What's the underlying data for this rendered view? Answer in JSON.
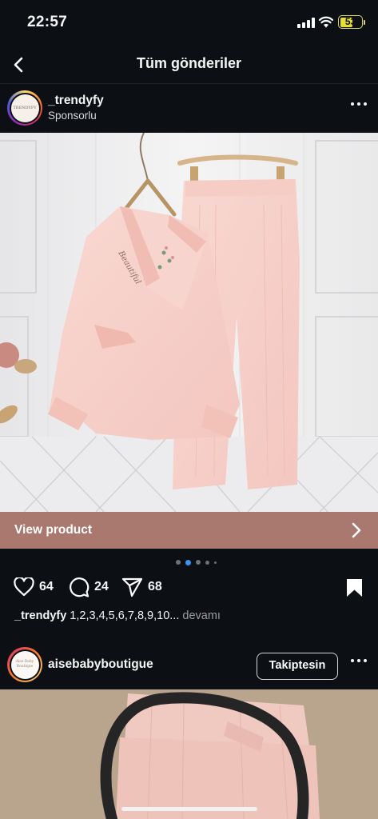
{
  "status_bar": {
    "time": "22:57",
    "battery": "53"
  },
  "nav": {
    "title": "Tüm gönderiler"
  },
  "post1": {
    "username": "_trendyfy",
    "label": "Sponsorlu",
    "avatar_text": "TRENDYFY",
    "embroidery_text": "Beautiful",
    "cta": "View product",
    "likes": "64",
    "comments": "24",
    "shares": "68",
    "caption_user": "_trendyfy",
    "caption_text": " 1,2,3,4,5,6,7,8,9,10... ",
    "caption_more": "devamı",
    "carousel_active_index": 2,
    "carousel_count": 5
  },
  "post2": {
    "username": "aisebabyboutigue",
    "follow_label": "Takiptesin",
    "avatar_text": "Aise Baby Boutique"
  },
  "icons": [
    "back-icon",
    "more-icon",
    "heart-icon",
    "comment-icon",
    "share-icon",
    "bookmark-icon",
    "chevron-right-icon"
  ]
}
